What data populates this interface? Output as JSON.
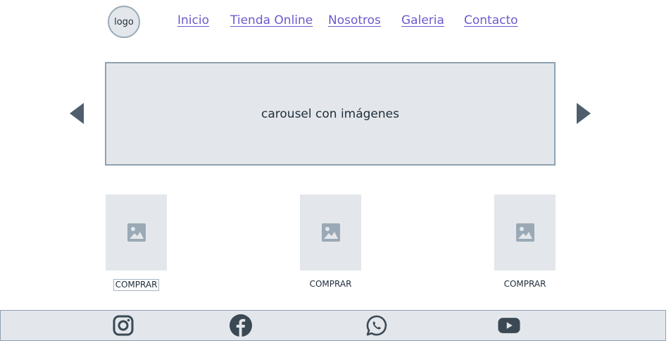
{
  "header": {
    "logo_text": "logo",
    "nav": [
      "Inicio",
      "Tienda Online",
      "Nosotros",
      "Galeria",
      "Contacto"
    ]
  },
  "carousel": {
    "text": "carousel con imágenes",
    "prev_icon": "triangle-left-icon",
    "next_icon": "triangle-right-icon"
  },
  "products": [
    {
      "icon": "image-placeholder-icon",
      "button": "COMPRAR"
    },
    {
      "icon": "image-placeholder-icon",
      "button": "COMPRAR"
    },
    {
      "icon": "image-placeholder-icon",
      "button": "COMPRAR"
    }
  ],
  "footer": {
    "icons": [
      "instagram-icon",
      "facebook-icon",
      "whatsapp-icon",
      "youtube-icon"
    ]
  },
  "colors": {
    "link": "#6a5acd",
    "panel": "#e3e7eb",
    "border": "#8fa1b1",
    "arrow": "#4e5e6c",
    "icon": "#3b4954"
  }
}
